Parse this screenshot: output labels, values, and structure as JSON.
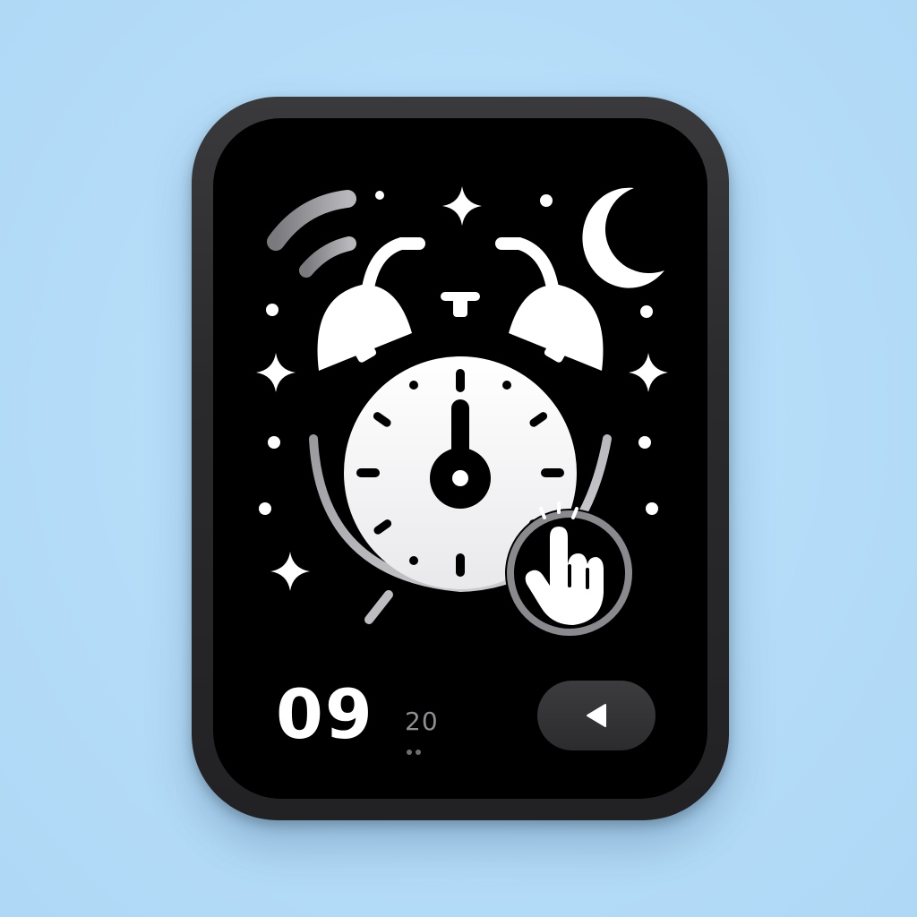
{
  "clock": {
    "hours": "09",
    "minutes": "20"
  },
  "icons": {
    "main": "alarm-clock-icon",
    "tap": "tap-hand-icon",
    "moon": "crescent-moon-icon",
    "sound": "sound-waves-icon",
    "back": "play-back-icon",
    "decor": "sparkle-icon"
  },
  "colors": {
    "background": "#b6dffa",
    "device_bezel": "#2a2a2c",
    "screen": "#000000",
    "foreground": "#ffffff",
    "muted": "#8e8e93",
    "button": "#2c2c2e"
  }
}
